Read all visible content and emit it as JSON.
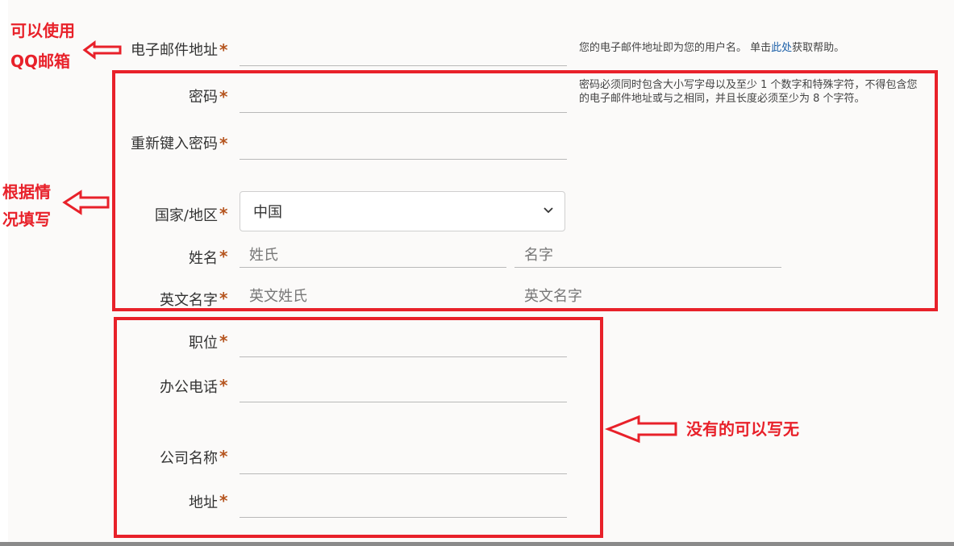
{
  "form": {
    "email_label": "电子邮件地址",
    "email_help_prefix": "您的电子邮件地址即为您的用户名。 单击",
    "email_help_link": "此处",
    "email_help_suffix": "获取帮助。",
    "password_label": "密码",
    "password_help": "密码必须同时包含大小写字母以及至少 1 个数字和特殊字符，不得包含您的电子邮件地址或与之相同，并且长度必须至少为 8 个字符。",
    "reenter_password_label": "重新键入密码",
    "country_label": "国家/地区",
    "country_selected": "中国",
    "name_label": "姓名",
    "last_name_placeholder": "姓氏",
    "first_name_placeholder": "名字",
    "english_name_label": "英文名字",
    "english_last_name_placeholder": "英文姓氏",
    "english_first_name_placeholder": "英文名字",
    "job_title_label": "职位",
    "office_phone_label": "办公电话",
    "company_label": "公司名称",
    "address_label": "地址",
    "required_mark": "*"
  },
  "annotations": {
    "email_note_line1": "可以使用",
    "email_note_line2": "QQ邮箱",
    "fill_note_line1": "根据情",
    "fill_note_line2": "况填写",
    "optional_note": "没有的可以写无",
    "color": "#e8212a"
  },
  "icons": {
    "select_arrow": "chevron-down-icon",
    "arrow": "hollow-left-arrow-icon"
  }
}
